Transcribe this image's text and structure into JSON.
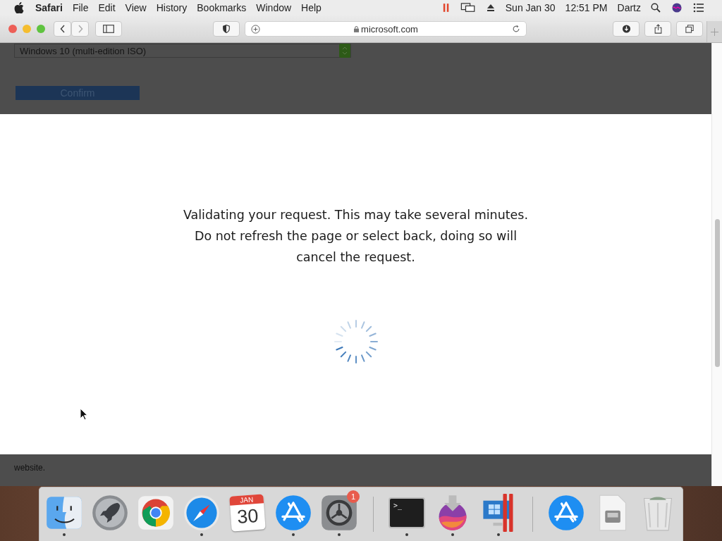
{
  "menu_bar": {
    "app": "Safari",
    "items": [
      "File",
      "Edit",
      "View",
      "History",
      "Bookmarks",
      "Window",
      "Help"
    ],
    "date": "Sun Jan 30",
    "time": "12:51 PM",
    "user": "Dartz"
  },
  "toolbar": {
    "url": "microsoft.com"
  },
  "page": {
    "select_value": "Windows 10 (multi-edition ISO)",
    "confirm_button": "Confirm",
    "footer_text": "website."
  },
  "modal": {
    "lines": [
      "Validating your request. This may take several minutes.",
      "Do not refresh the page or select back, doing so will",
      "cancel the request."
    ]
  },
  "dock": [
    {
      "kind": "finder",
      "running": true
    },
    {
      "kind": "launchpad",
      "running": false
    },
    {
      "kind": "chrome",
      "running": false
    },
    {
      "kind": "safari",
      "running": true
    },
    {
      "kind": "calendar",
      "running": false,
      "month": "JAN",
      "day": "30"
    },
    {
      "kind": "appstore",
      "running": true
    },
    {
      "kind": "settings",
      "running": true,
      "badge": "1"
    },
    {
      "kind": "separator"
    },
    {
      "kind": "terminal",
      "running": true,
      "prompt": ">_"
    },
    {
      "kind": "installer",
      "running": true
    },
    {
      "kind": "parallels",
      "running": true
    },
    {
      "kind": "separator"
    },
    {
      "kind": "appstore",
      "running": false
    },
    {
      "kind": "document",
      "running": false
    },
    {
      "kind": "trash",
      "running": false
    }
  ]
}
